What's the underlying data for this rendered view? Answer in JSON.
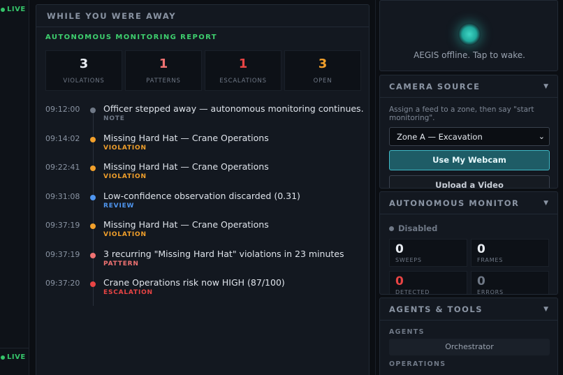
{
  "sidebar": {
    "live_top": "LIVE",
    "live_bottom": "LIVE"
  },
  "main": {
    "header": "WHILE YOU WERE AWAY",
    "report_title": "AUTONOMOUS MONITORING REPORT",
    "stats": [
      {
        "value": "3",
        "label": "VIOLATIONS",
        "color": "#e9edf2"
      },
      {
        "value": "1",
        "label": "PATTERNS",
        "color": "#f07272"
      },
      {
        "value": "1",
        "label": "ESCALATIONS",
        "color": "#e84444"
      },
      {
        "value": "3",
        "label": "OPEN",
        "color": "#f2a02b"
      }
    ],
    "events": [
      {
        "time": "09:12:00",
        "title": "Officer stepped away — autonomous monitoring continues.",
        "tag": "NOTE",
        "color": "#6f7886"
      },
      {
        "time": "09:14:02",
        "title": "Missing Hard Hat — Crane Operations",
        "tag": "VIOLATION",
        "color": "#f2a02b"
      },
      {
        "time": "09:22:41",
        "title": "Missing Hard Hat — Crane Operations",
        "tag": "VIOLATION",
        "color": "#f2a02b"
      },
      {
        "time": "09:31:08",
        "title": "Low-confidence observation discarded (0.31)",
        "tag": "REVIEW",
        "color": "#4f96f0"
      },
      {
        "time": "09:37:19",
        "title": "Missing Hard Hat — Crane Operations",
        "tag": "VIOLATION",
        "color": "#f2a02b"
      },
      {
        "time": "09:37:19",
        "title": "3 recurring \"Missing Hard Hat\" violations in 23 minutes",
        "tag": "PATTERN",
        "color": "#f07272"
      },
      {
        "time": "09:37:20",
        "title": "Crane Operations risk now HIGH (87/100)",
        "tag": "ESCALATION",
        "color": "#e84444"
      }
    ]
  },
  "aegis": {
    "status_text": "AEGIS offline. Tap to wake."
  },
  "camera": {
    "header": "CAMERA SOURCE",
    "description": "Assign a feed to a zone, then say \"start monitoring\".",
    "zone_selected": "Zone A — Excavation",
    "webcam_button": "Use My Webcam",
    "upload_button": "Upload a Video"
  },
  "monitor": {
    "header": "AUTONOMOUS MONITOR",
    "status": "Disabled",
    "metrics": [
      {
        "value": "0",
        "label": "SWEEPS",
        "color": "#e9edf2"
      },
      {
        "value": "0",
        "label": "FRAMES",
        "color": "#e9edf2"
      },
      {
        "value": "0",
        "label": "DETECTED",
        "color": "#e84444"
      },
      {
        "value": "0",
        "label": "ERRORS",
        "color": "#6f7886"
      }
    ]
  },
  "agents": {
    "header": "AGENTS & TOOLS",
    "agents_label": "AGENTS",
    "orchestrator": "Orchestrator",
    "operations_label": "OPERATIONS"
  }
}
